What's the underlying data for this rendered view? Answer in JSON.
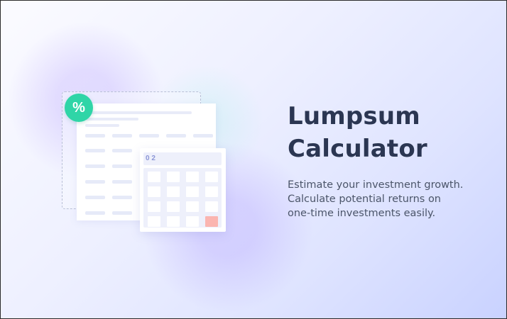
{
  "hero": {
    "title_line1": "Lumpsum",
    "title_line2": "Calculator",
    "description_lines": [
      "Estimate your investment growth.",
      "Calculate potential returns on",
      "one-time investments easily."
    ]
  },
  "illustration": {
    "badge_symbol": "%",
    "calculator_display": "0 2",
    "icons": [
      "percent-icon",
      "spreadsheet-icon",
      "calculator-icon"
    ]
  },
  "colors": {
    "title": "#2b3652",
    "body_text": "#4b5569",
    "badge": "#2fd5a7",
    "accent_key": "#fbb5b0",
    "background_end": "#c9d2ff"
  }
}
